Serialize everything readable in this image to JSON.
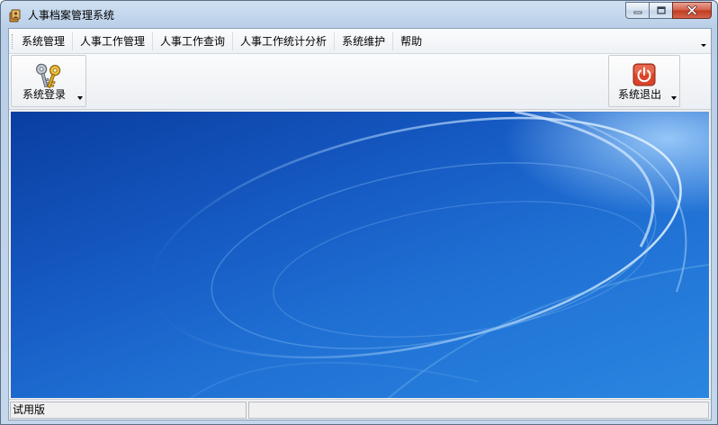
{
  "window": {
    "title": "人事档案管理系统"
  },
  "menu": {
    "items": [
      {
        "label": "系统管理"
      },
      {
        "label": "人事工作管理"
      },
      {
        "label": "人事工作查询"
      },
      {
        "label": "人事工作统计分析"
      },
      {
        "label": "系统维护"
      },
      {
        "label": "帮助"
      }
    ]
  },
  "toolbar": {
    "login": {
      "label": "系统登录",
      "icon": "keys-icon"
    },
    "exit": {
      "label": "系统退出",
      "icon": "power-icon"
    }
  },
  "statusbar": {
    "pane1": "试用版",
    "pane2": ""
  },
  "colors": {
    "desktop_accent": "#1f6fd3",
    "exit_icon": "#d9452a"
  }
}
